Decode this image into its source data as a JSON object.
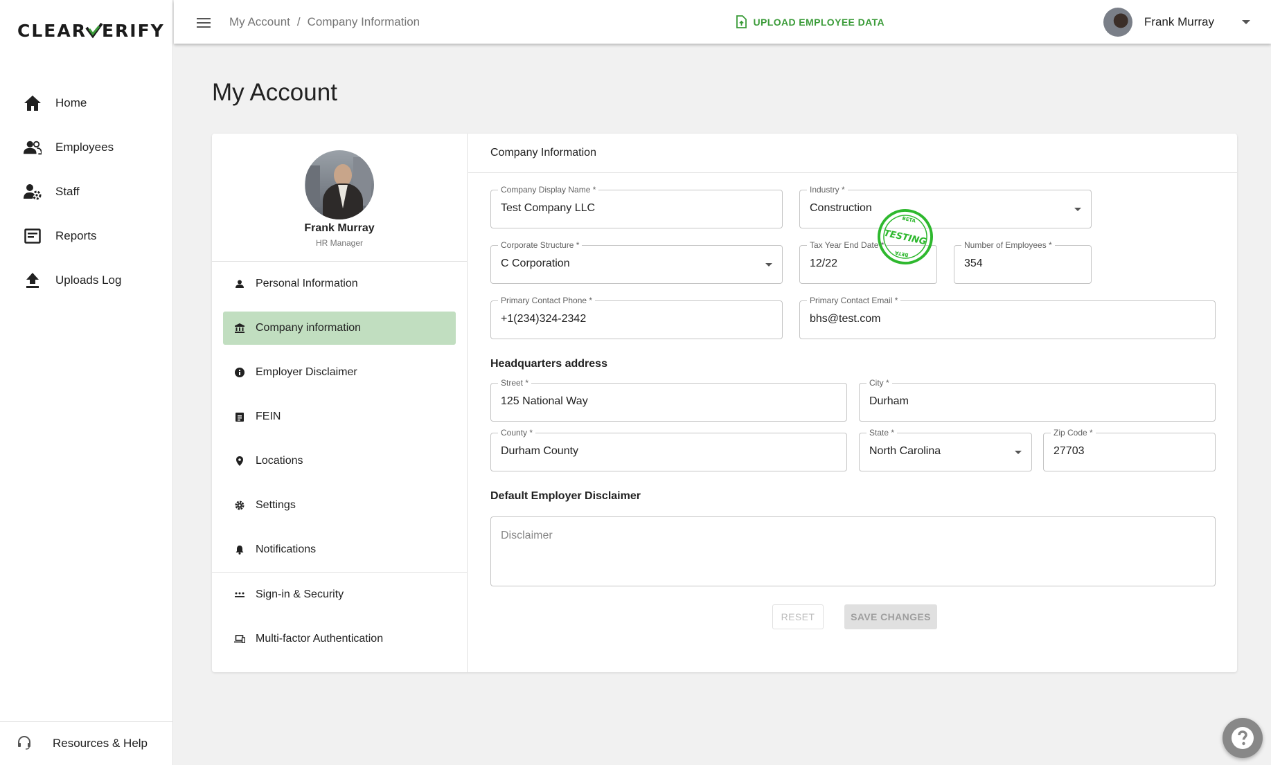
{
  "brand": {
    "logo_left": "CLEAR",
    "logo_right": "ERIFY",
    "accent": "#3a9b38"
  },
  "nav": {
    "items": [
      {
        "label": "Home",
        "icon": "home-icon"
      },
      {
        "label": "Employees",
        "icon": "people-icon"
      },
      {
        "label": "Staff",
        "icon": "staff-settings-icon"
      },
      {
        "label": "Reports",
        "icon": "reports-icon"
      },
      {
        "label": "Uploads Log",
        "icon": "upload-icon"
      }
    ],
    "resources_label": "Resources & Help"
  },
  "topbar": {
    "breadcrumb": [
      "My Account",
      "Company Information"
    ],
    "breadcrumb_sep": "/",
    "upload_label": "UPLOAD EMPLOYEE DATA",
    "user_name": "Frank Murray"
  },
  "page": {
    "title": "My Account"
  },
  "profile": {
    "name": "Frank Murray",
    "role": "HR Manager"
  },
  "account_menu": [
    {
      "label": "Personal Information",
      "icon": "person-icon",
      "active": false
    },
    {
      "label": "Company information",
      "icon": "bank-icon",
      "active": true
    },
    {
      "label": "Employer Disclaimer",
      "icon": "info-icon",
      "active": false
    },
    {
      "label": "FEIN",
      "icon": "clipboard-icon",
      "active": false
    },
    {
      "label": "Locations",
      "icon": "location-pin-icon",
      "active": false
    },
    {
      "label": "Settings",
      "icon": "gear-icon",
      "active": false
    },
    {
      "label": "Notifications",
      "icon": "bell-icon",
      "active": false
    },
    {
      "label": "Sign-in & Security",
      "icon": "password-icon",
      "active": false
    },
    {
      "label": "Multi-factor Authentication",
      "icon": "devices-icon",
      "active": false
    }
  ],
  "company_form": {
    "section_title": "Company Information",
    "company_display_name": {
      "label": "Company Display Name *",
      "value": "Test Company LLC"
    },
    "industry": {
      "label": "Industry *",
      "value": "Construction"
    },
    "corporate_structure": {
      "label": "Corporate Structure *",
      "value": "C Corporation"
    },
    "tax_year_end_date": {
      "label": "Tax Year End Date *",
      "value": "12/22"
    },
    "number_of_employees": {
      "label": "Number of Employees *",
      "value": "354"
    },
    "primary_contact_phone": {
      "label": "Primary Contact Phone *",
      "value": "+1(234)324-2342"
    },
    "primary_contact_email": {
      "label": "Primary Contact Email *",
      "value": "bhs@test.com"
    },
    "hq_heading": "Headquarters address",
    "street": {
      "label": "Street *",
      "value": "125 National Way"
    },
    "city": {
      "label": "City *",
      "value": "Durham"
    },
    "county": {
      "label": "County *",
      "value": "Durham County"
    },
    "state": {
      "label": "State *",
      "value": "North Carolina"
    },
    "zip": {
      "label": "Zip Code *",
      "value": "27703"
    },
    "disclaimer_heading": "Default Employer Disclaimer",
    "disclaimer_placeholder": "Disclaimer",
    "reset_label": "RESET",
    "save_label": "SAVE CHANGES"
  },
  "stamp": {
    "top": "BETA",
    "middle": "TESTING",
    "bottom": "BETA",
    "color": "#2eb82e"
  }
}
